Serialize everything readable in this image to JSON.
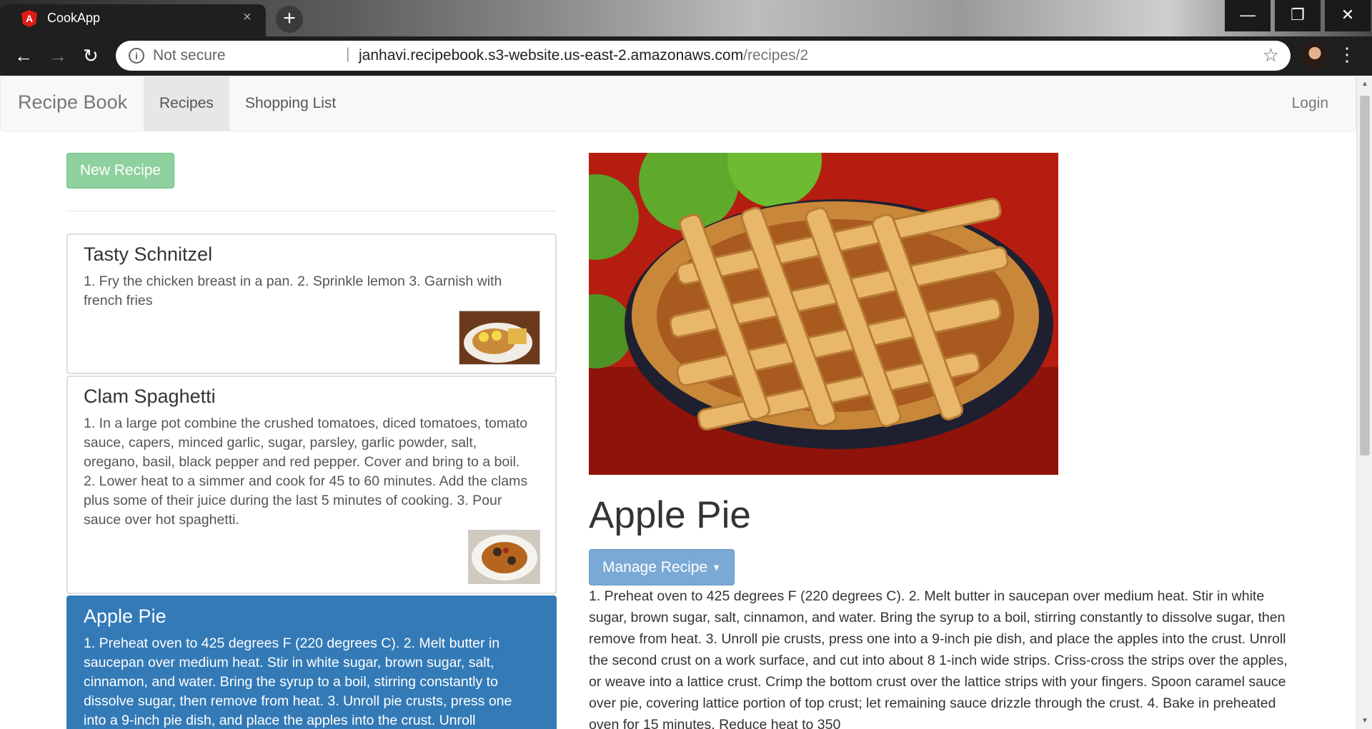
{
  "browser": {
    "tab_title": "CookApp",
    "tab_close": "×",
    "new_tab": "+",
    "security_label": "Not secure",
    "url_host": "janhavi.recipebook.s3-website.us-east-2.amazonaws.com",
    "url_path": "/recipes/2",
    "window_controls": {
      "minimize": "—",
      "restore": "❐",
      "close": "✕"
    },
    "nav": {
      "back": "←",
      "forward": "→",
      "reload": "↻"
    }
  },
  "navbar": {
    "brand": "Recipe Book",
    "links": [
      {
        "label": "Recipes",
        "active": true
      },
      {
        "label": "Shopping List",
        "active": false
      }
    ],
    "login": "Login"
  },
  "sidebar": {
    "new_recipe_label": "New Recipe",
    "recipes": [
      {
        "name": "Tasty Schnitzel",
        "description": "1. Fry the chicken breast in a pan. 2. Sprinkle lemon 3. Garnish with french fries",
        "active": false
      },
      {
        "name": "Clam Spaghetti",
        "description": "1. In a large pot combine the crushed tomatoes, diced tomatoes, tomato sauce, capers, minced garlic, sugar, parsley, garlic powder, salt, oregano, basil, black pepper and red pepper. Cover and bring to a boil. 2. Lower heat to a simmer and cook for 45 to 60 minutes. Add the clams plus some of their juice during the last 5 minutes of cooking. 3. Pour sauce over hot spaghetti.",
        "active": false
      },
      {
        "name": "Apple Pie",
        "description": "1. Preheat oven to 425 degrees F (220 degrees C). 2. Melt butter in saucepan over medium heat. Stir in white sugar, brown sugar, salt, cinnamon, and water. Bring the syrup to a boil, stirring constantly to dissolve sugar, then remove from heat. 3. Unroll pie crusts, press one into a 9-inch pie dish, and place the apples into the crust. Unroll",
        "active": true
      }
    ]
  },
  "detail": {
    "name": "Apple Pie",
    "manage_label": "Manage Recipe",
    "description": "1. Preheat oven to 425 degrees F (220 degrees C). 2. Melt butter in saucepan over medium heat. Stir in white sugar, brown sugar, salt, cinnamon, and water. Bring the syrup to a boil, stirring constantly to dissolve sugar, then remove from heat. 3. Unroll pie crusts, press one into a 9-inch pie dish, and place the apples into the crust. Unroll the second crust on a work surface, and cut into about 8 1-inch wide strips. Criss-cross the strips over the apples, or weave into a lattice crust. Crimp the bottom crust over the lattice strips with your fingers. Spoon caramel sauce over pie, covering lattice portion of top crust; let remaining sauce drizzle through the crust. 4. Bake in preheated oven for 15 minutes. Reduce heat to 350"
  },
  "colors": {
    "active_item": "#337ab7",
    "success_button": "#8fd19e",
    "primary_button": "#7aa9d6"
  }
}
